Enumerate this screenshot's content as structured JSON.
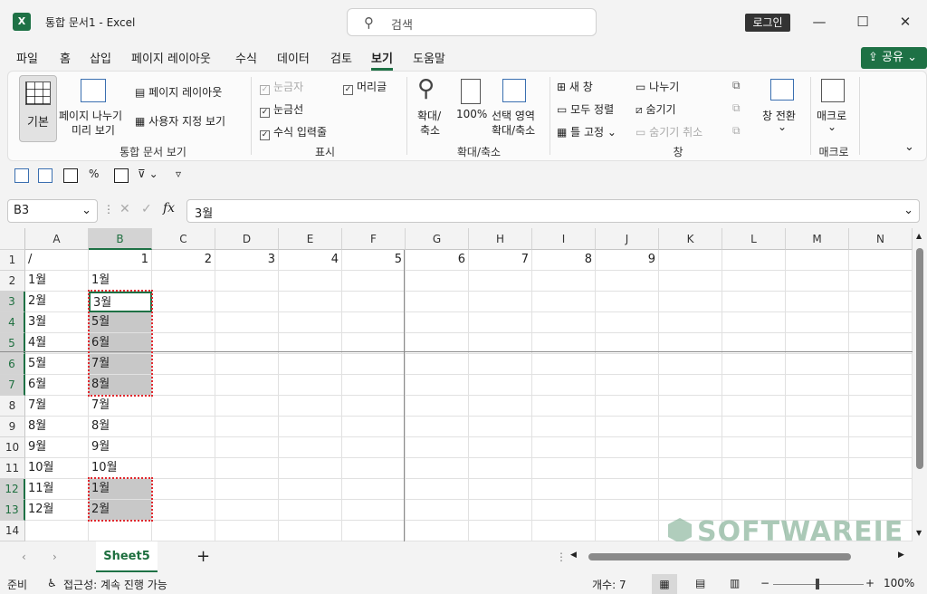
{
  "window": {
    "doc_title": "통합 문서1  -  Excel",
    "app_icon": "X",
    "search_placeholder": "검색",
    "login_label": "로그인"
  },
  "tabs": [
    "파일",
    "홈",
    "삽입",
    "페이지 레이아웃",
    "수식",
    "데이터",
    "검토",
    "보기",
    "도움말"
  ],
  "active_tab": "보기",
  "share_label": "공유",
  "ribbon": {
    "normal": "기본",
    "page_break_1": "페이지 나누기",
    "page_break_2": "미리 보기",
    "page_layout": "페이지 레이아웃",
    "custom_view": "사용자 지정 보기",
    "group_workbook_views": "통합 문서 보기",
    "ruler": "눈금자",
    "gridlines": "눈금선",
    "formula_bar": "수식 입력줄",
    "headings": "머리글",
    "group_show": "표시",
    "zoom_1": "확대/",
    "zoom_2": "축소",
    "zoom_100": "100%",
    "zoom_sel_1": "선택 영역",
    "zoom_sel_2": "확대/축소",
    "group_zoom": "확대/축소",
    "new_window": "새 창",
    "arrange_all": "모두 정렬",
    "freeze_panes": "틀 고정",
    "split": "나누기",
    "hide": "숨기기",
    "unhide": "숨기기 취소",
    "switch_windows": "창 전환",
    "group_window": "창",
    "macros": "매크로",
    "group_macros": "매크로"
  },
  "formula_bar": {
    "name_box": "B3",
    "fx": "fx",
    "content": "3월"
  },
  "columns": [
    "A",
    "B",
    "C",
    "D",
    "E",
    "F",
    "G",
    "H",
    "I",
    "J",
    "K",
    "L",
    "M",
    "N"
  ],
  "rows": [
    "1",
    "2",
    "3",
    "4",
    "5",
    "6",
    "7",
    "8",
    "9",
    "10",
    "11",
    "12",
    "13",
    "14"
  ],
  "row1": [
    "/",
    "1",
    "2",
    "3",
    "4",
    "5",
    "6",
    "7",
    "8",
    "9"
  ],
  "colA": [
    "1월",
    "2월",
    "3월",
    "4월",
    "5월",
    "6월",
    "7월",
    "8월",
    "9월",
    "10월",
    "11월",
    "12월"
  ],
  "colB": [
    "1월",
    "3월",
    "5월",
    "6월",
    "7월",
    "8월",
    "7월",
    "8월",
    "9월",
    "10월",
    "1월",
    "2월"
  ],
  "sheet_tab": "Sheet5",
  "status": {
    "ready": "준비",
    "accessibility": "접근성: 계속 진행 가능",
    "count": "개수: 7",
    "zoom": "100%"
  },
  "watermark": "SOFTWAREIE"
}
